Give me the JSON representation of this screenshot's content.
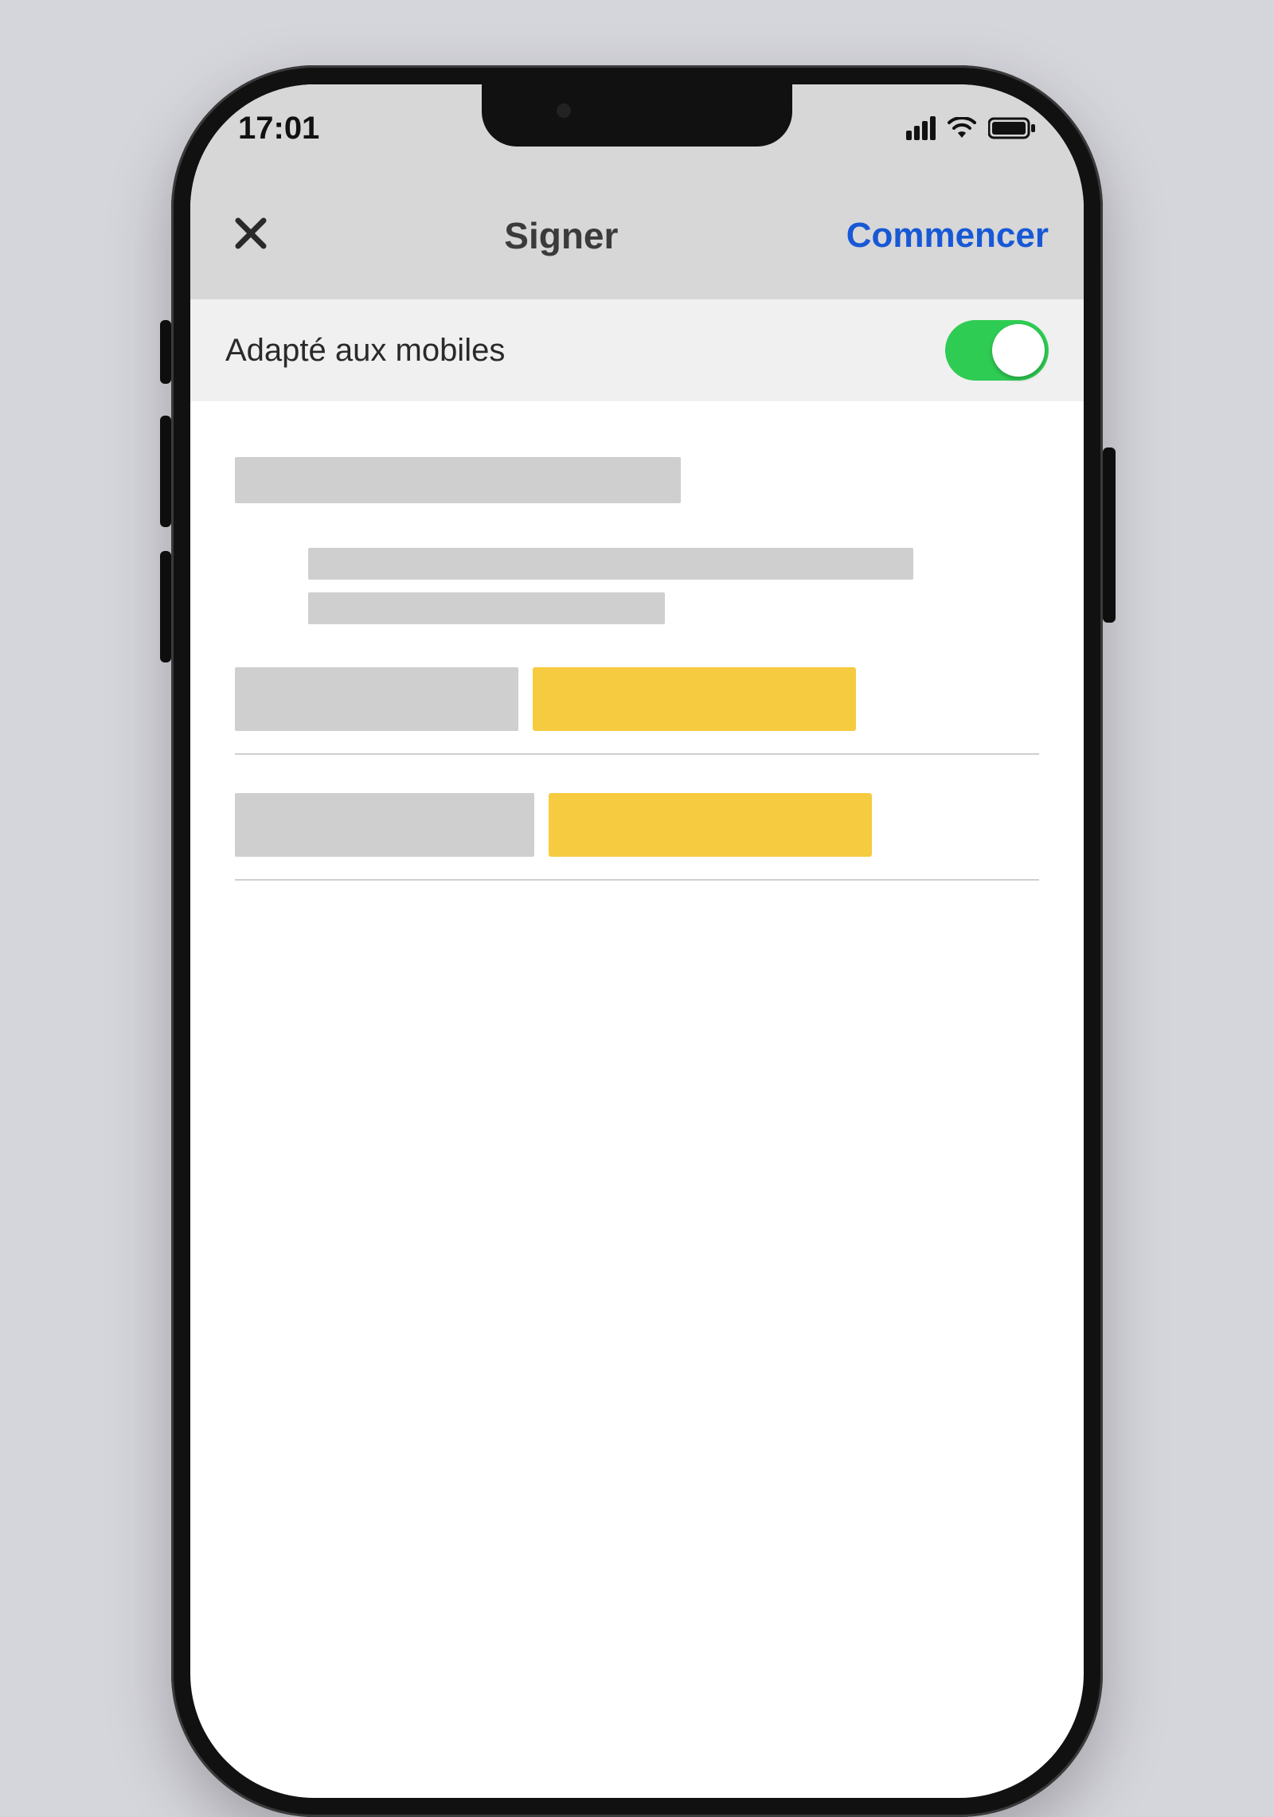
{
  "status": {
    "time": "17:01"
  },
  "nav": {
    "title": "Signer",
    "action": "Commencer"
  },
  "toggle": {
    "label": "Adapté aux mobiles",
    "on": true
  }
}
